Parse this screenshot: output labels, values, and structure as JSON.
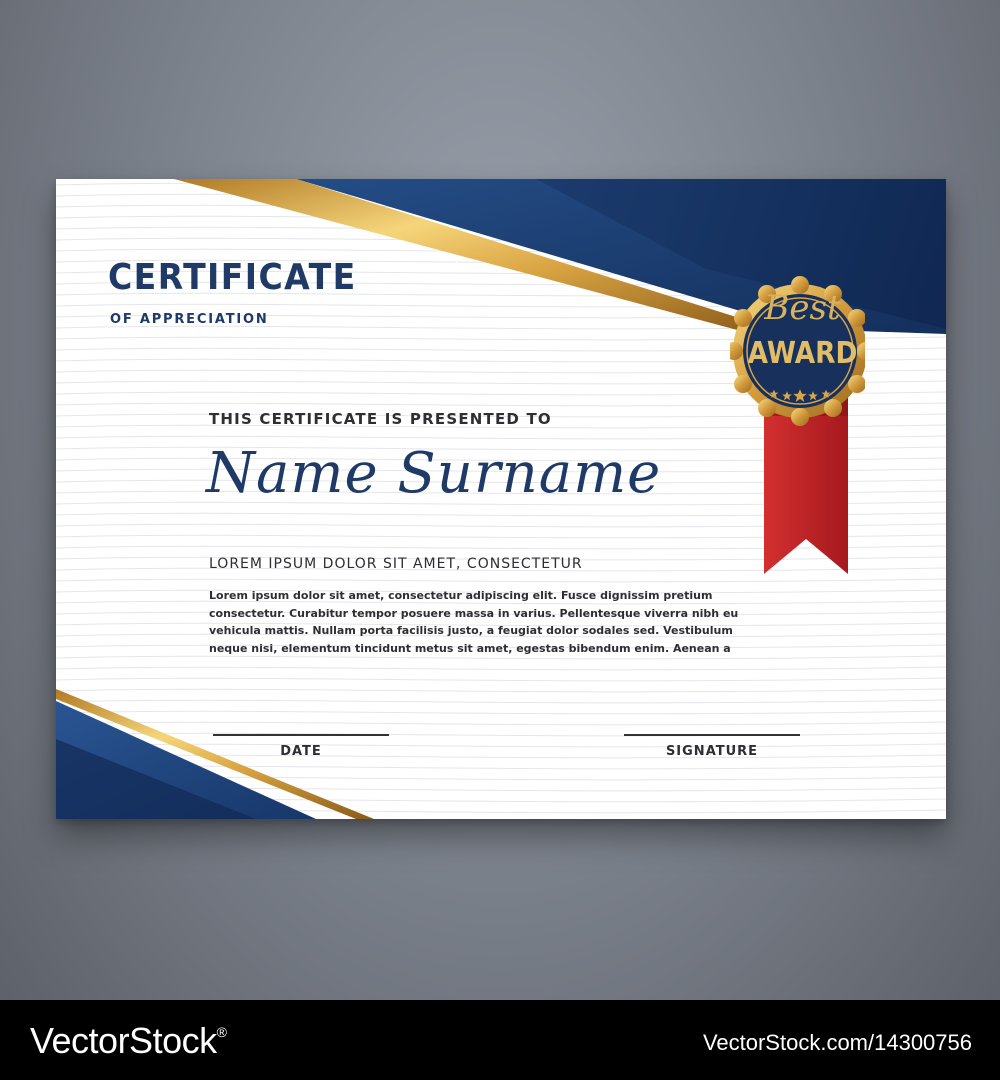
{
  "certificate": {
    "title": "CERTIFICATE",
    "subtitle": "OF APPRECIATION",
    "presented_to": "THIS CERTIFICATE IS PRESENTED TO",
    "recipient_name": "Name Surname",
    "lorem_heading": "LOREM IPSUM DOLOR SIT AMET, CONSECTETUR",
    "body_lines": [
      "Lorem ipsum dolor sit amet, consectetur adipiscing elit. Fusce dignissim pretium",
      "consectetur. Curabitur tempor posuere massa in varius. Pellentesque viverra nibh eu",
      "vehicula mattis. Nullam porta facilisis justo, a feugiat dolor sodales sed. Vestibulum",
      "neque nisi, elementum tincidunt metus sit amet, egestas bibendum enim. Aenean a"
    ],
    "date_label": "DATE",
    "signature_label": "SIGNATURE"
  },
  "badge": {
    "best": "Best",
    "award": "AWARD",
    "star_count": 5
  },
  "footer": {
    "brand": "VectorStock",
    "registered_mark": "®",
    "image_id": "VectorStock.com/14300756"
  },
  "colors": {
    "navy": "#1f3a66",
    "dark_blue": "#163463",
    "gold": "#d8a548",
    "ribbon_red": "#c8262b",
    "background": "#7f858f"
  }
}
